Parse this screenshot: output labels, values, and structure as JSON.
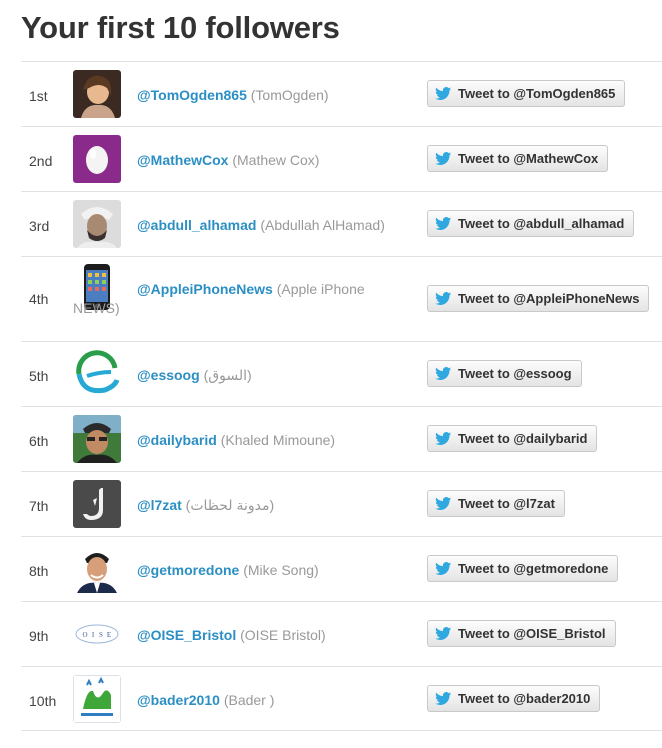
{
  "page": {
    "title": "Your first 10 followers"
  },
  "colors": {
    "link": "#2b8fc4",
    "bird": "#2fa8e0",
    "border": "#e2e2e2"
  },
  "followers": [
    {
      "rank": "1st",
      "handle": "@TomOgden865",
      "name": "(TomOgden)",
      "button": "Tweet to @TomOgden865",
      "avatar": "photo-woman"
    },
    {
      "rank": "2nd",
      "handle": "@MathewCox",
      "name": "(Mathew Cox)",
      "button": "Tweet to @MathewCox",
      "avatar": "default-egg"
    },
    {
      "rank": "3rd",
      "handle": "@abdull_alhamad",
      "name": "(Abdullah AlHamad)",
      "button": "Tweet to @abdull_alhamad",
      "avatar": "photo-man"
    },
    {
      "rank": "4th",
      "handle": "@AppleiPhoneNews",
      "name": "(Apple iPhone NEWS)",
      "button": "Tweet to @AppleiPhoneNews",
      "avatar": "iphone"
    },
    {
      "rank": "5th",
      "handle": "@essoog",
      "name": "(السوق)",
      "button": "Tweet to @essoog",
      "avatar": "essoog-logo"
    },
    {
      "rank": "6th",
      "handle": "@dailybarid",
      "name": "(Khaled Mimoune)",
      "button": "Tweet to @dailybarid",
      "avatar": "photo-man-hat"
    },
    {
      "rank": "7th",
      "handle": "@l7zat",
      "name": "(مدونة لحظات)",
      "button": "Tweet to @l7zat",
      "avatar": "l7zat-logo"
    },
    {
      "rank": "8th",
      "handle": "@getmoredone",
      "name": "(Mike Song)",
      "button": "Tweet to @getmoredone",
      "avatar": "photo-man-suit"
    },
    {
      "rank": "9th",
      "handle": "@OISE_Bristol",
      "name": "(OISE Bristol)",
      "button": "Tweet to @OISE_Bristol",
      "avatar": "oise-logo"
    },
    {
      "rank": "10th",
      "handle": "@bader2010",
      "name": "(Bader )",
      "button": "Tweet to @bader2010",
      "avatar": "bader-logo"
    }
  ]
}
